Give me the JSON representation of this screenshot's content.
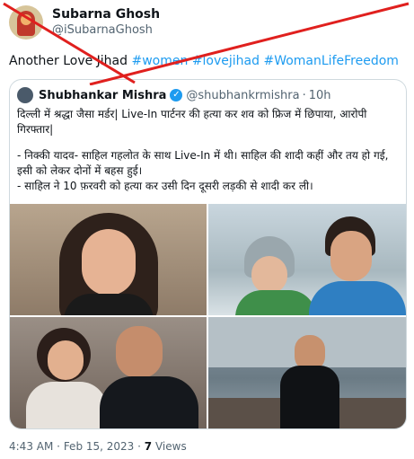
{
  "author": {
    "display_name": "Subarna Ghosh",
    "handle": "@iSubarnaGhosh"
  },
  "tweet": {
    "text_prefix": "Another Love Jihad",
    "hashtags": [
      "#women",
      "#lovejihad",
      "#WomanLifeFreedom"
    ]
  },
  "quoted": {
    "display_name": "Shubhankar Mishra",
    "handle": "@shubhankrmishra",
    "time": "10h",
    "lines": [
      "दिल्ली में श्रद्धा जैसा मर्डर| Live-In पार्टनर की हत्या कर शव को फ्रिज में छिपाया, आरोपी",
      "गिरफ्तार|",
      "- निक्की यादव- साहिल गहलोत के साथ Live-In में थी। साहिल की शादी कहीं और तय हो गई,",
      "इसी को लेकर दोनों में बहस हुई।",
      "- साहिल ने 10 फ़रवरी को हत्या कर उसी दिन दूसरी लड़की से शादी कर ली।"
    ]
  },
  "footer": {
    "time": "4:43 AM",
    "date": "Feb 15, 2023",
    "views_count": "7",
    "views_label": "Views"
  },
  "colors": {
    "link": "#1d9bf0",
    "cross": "#e0201e",
    "border": "#cfd9de"
  }
}
